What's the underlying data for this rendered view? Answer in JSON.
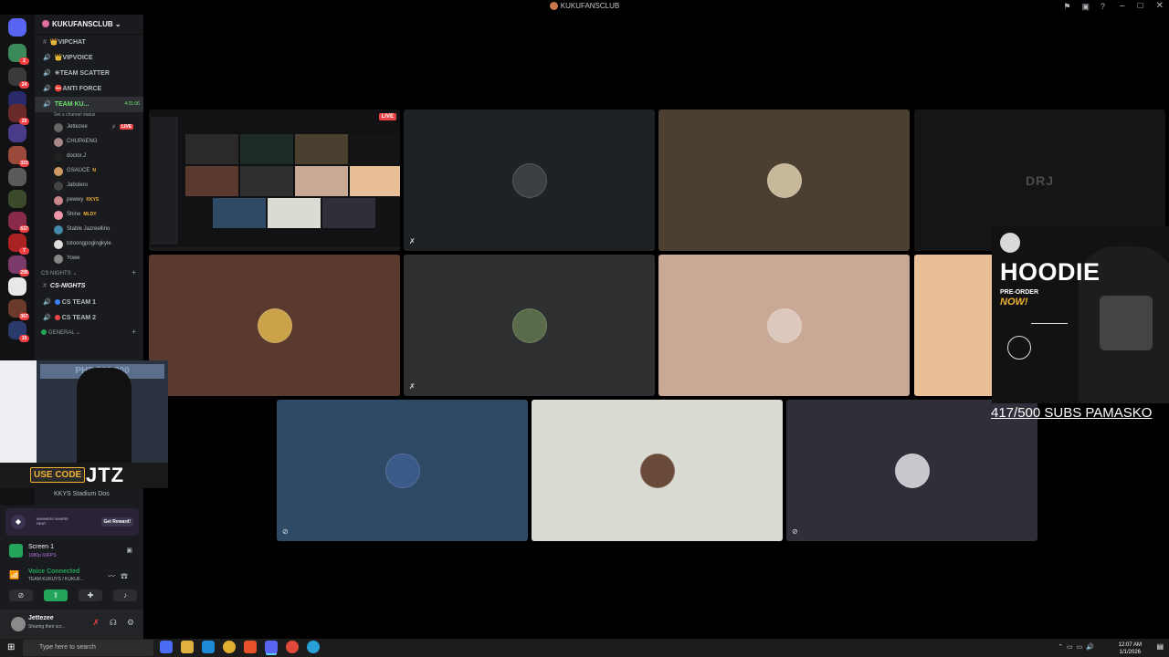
{
  "window": {
    "title": "KUKUFANSCLUB"
  },
  "server": {
    "name": "KUKUFANSCLUB"
  },
  "channels": [
    {
      "name": "VIPCHAT",
      "prefix": "👑",
      "type": "text"
    },
    {
      "name": "VIPVOICE",
      "prefix": "👑",
      "type": "voice"
    },
    {
      "name": "TEAM SCATTER",
      "prefix": "✳",
      "type": "voice"
    },
    {
      "name": "ANTI FORCE",
      "prefix": "⛔",
      "type": "voice"
    }
  ],
  "active_channel": {
    "name": "TEAM KU...",
    "timer": "4:31:06",
    "status_hint": "Set a channel status"
  },
  "members": [
    {
      "name": "Jettezee",
      "live": "LIVE"
    },
    {
      "name": "CHUPAENG"
    },
    {
      "name": "doctor.J"
    },
    {
      "name": "GSAUCE",
      "tag": "N"
    },
    {
      "name": "Jabolero"
    },
    {
      "name": "pewwy",
      "tag": "KKYS"
    },
    {
      "name": "Shine",
      "tag": "MLDY"
    },
    {
      "name": "Stable Jazreellino"
    },
    {
      "name": "totoongpogingkyle"
    },
    {
      "name": "Yowe"
    }
  ],
  "categories": {
    "cs": "CS NIGHTS",
    "general": "GENERAL"
  },
  "cs_channels": [
    {
      "name": "CS-NIGHTS"
    },
    {
      "name": "CS TEAM 1",
      "color": "#3b82f6"
    },
    {
      "name": "CS TEAM 2",
      "color": "#ef4444"
    }
  ],
  "stage_channel": "KKYS Stadium Dos",
  "promo": {
    "text": "WINNERS WHERE HEAT",
    "button": "Get Reward!"
  },
  "stream": {
    "title": "Screen 1",
    "sub": "1080p 60FPS"
  },
  "voice": {
    "status": "Voice Connected",
    "channel": "TEAM KUKUYS / KUKUF..."
  },
  "user": {
    "name": "Jettezee",
    "status": "Sharing their scr..."
  },
  "tiles": [
    {
      "color": "#1f2224",
      "avatar": "#3a3f44",
      "muted": true
    },
    {
      "color": "#4a3f30",
      "avatar": "#c8b89a",
      "muted": false
    },
    {
      "color": "#141516",
      "name": "DRJ",
      "muted": false
    },
    {
      "color": "#5a3a2e",
      "avatar": "#c9a24a",
      "muted": false
    },
    {
      "color": "#2d2f30",
      "avatar": "#5a6b4a",
      "muted": true
    },
    {
      "color": "#c9a896",
      "avatar": "#dcc8bc",
      "muted": false
    },
    {
      "color": "#e8bf96",
      "muted": false
    },
    {
      "color": "#2e4a66",
      "avatar": "#3a5a8a",
      "muted": true
    },
    {
      "color": "#dadbd2",
      "avatar": "#6a4a3a",
      "muted": false
    },
    {
      "color": "#2e2f38",
      "avatar": "#c8c8cc",
      "muted": true
    }
  ],
  "screen_share": {
    "badge": "LIVE"
  },
  "ad": {
    "headline": "HOODIE",
    "pre": "PRE-ORDER",
    "now": "NOW!"
  },
  "subs_text": "417/500 SUBS PAMASKO",
  "webcam": {
    "banner": "PHP 200,000",
    "use_code": "USE CODE",
    "code": "JTZ"
  },
  "taskbar": {
    "search_placeholder": "Type here to search",
    "time": "12:07 AM",
    "date": "1/1/2026"
  },
  "guild_badges": [
    "2",
    "24",
    "",
    "20",
    "323",
    "",
    "637",
    "7",
    "295",
    "",
    "367",
    "10"
  ]
}
